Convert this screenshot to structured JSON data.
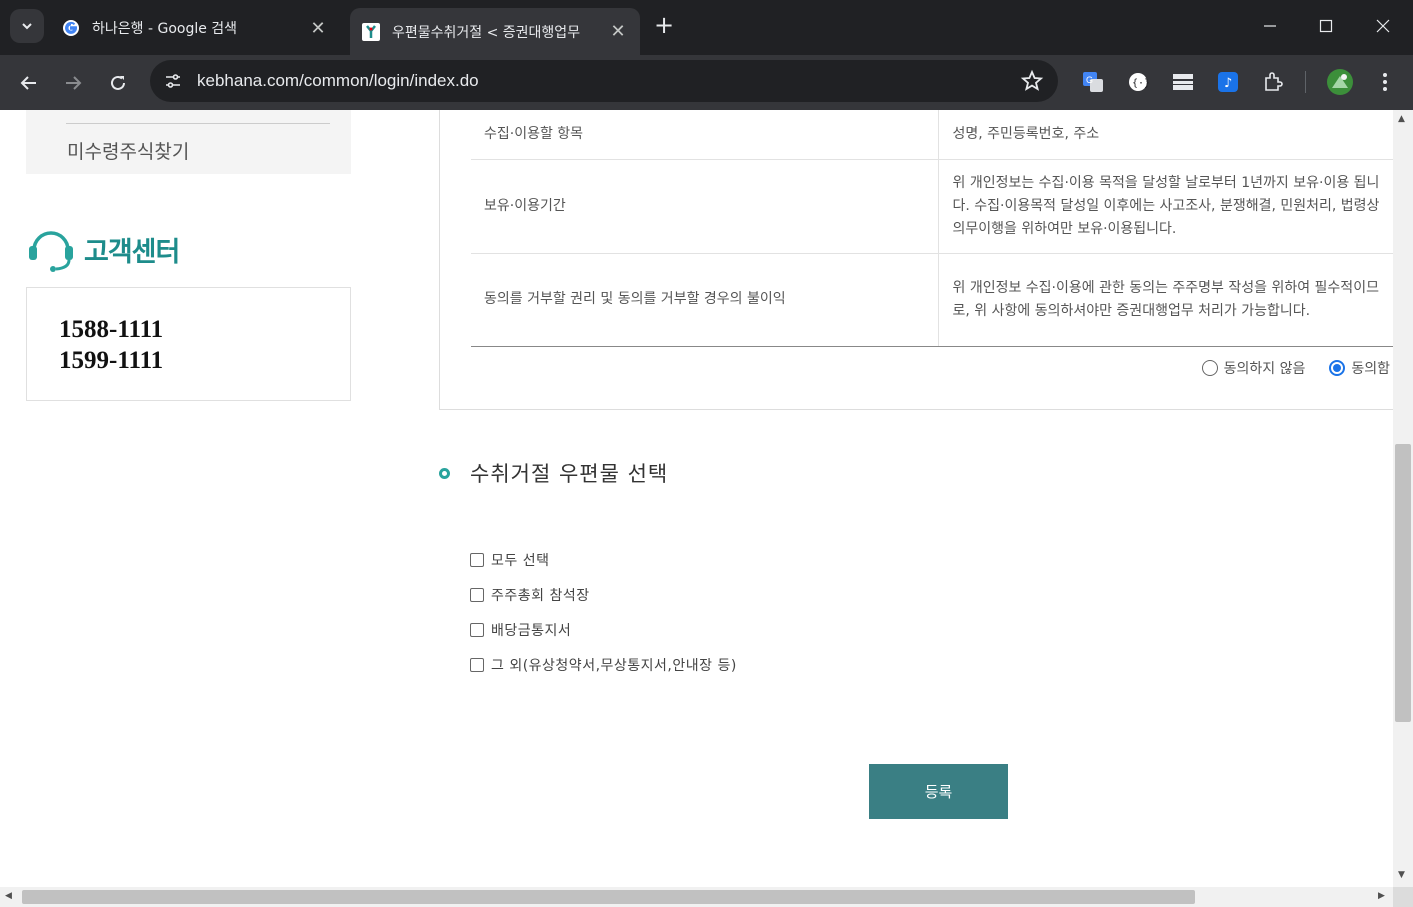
{
  "browser": {
    "tabs": [
      {
        "title": "하나은행 - Google 검색",
        "active": false,
        "icon": "google-favicon"
      },
      {
        "title": "우편물수취거절 < 증권대행업무",
        "active": true,
        "icon": "hana-favicon"
      }
    ],
    "url": "kebhana.com/common/login/index.do"
  },
  "sidebar": {
    "menu_item": "미수령주식찾기",
    "customer_center_title": "고객센터",
    "phones": [
      "1588-1111",
      "1599-1111"
    ]
  },
  "consent": {
    "rows": [
      {
        "label": "수집·이용할 항목",
        "value": "성명, 주민등록번호, 주소"
      },
      {
        "label": "보유·이용기간",
        "value": "위 개인정보는 수집·이용 목적을 달성할 날로부터 1년까지 보유·이용 됩니다. 수집·이용목적 달성일 이후에는 사고조사, 분쟁해결, 민원처리, 법령상 의무이행을 위하여만 보유·이용됩니다."
      },
      {
        "label": "동의를 거부할 권리 및 동의를 거부할 경우의 불이익",
        "value": "위 개인정보 수집·이용에 관한 동의는 주주명부 작성을 위하여 필수적이므로, 위 사항에 동의하셔야만 증권대행업무 처리가 가능합니다."
      }
    ],
    "disagree_label": "동의하지 않음",
    "agree_label": "동의함",
    "selected": "agree"
  },
  "mail_section": {
    "title": "수취거절 우편물 선택",
    "options": [
      {
        "label": "모두 선택",
        "checked": false
      },
      {
        "label": "주주총회 참석장",
        "checked": false
      },
      {
        "label": "배당금통지서",
        "checked": false
      },
      {
        "label": "그 외(유상청약서,무상통지서,안내장 등)",
        "checked": false
      }
    ],
    "submit_label": "등록"
  },
  "colors": {
    "accent": "#1d8c8b",
    "button": "#3a7f84",
    "radio_selected": "#1a73e8"
  }
}
